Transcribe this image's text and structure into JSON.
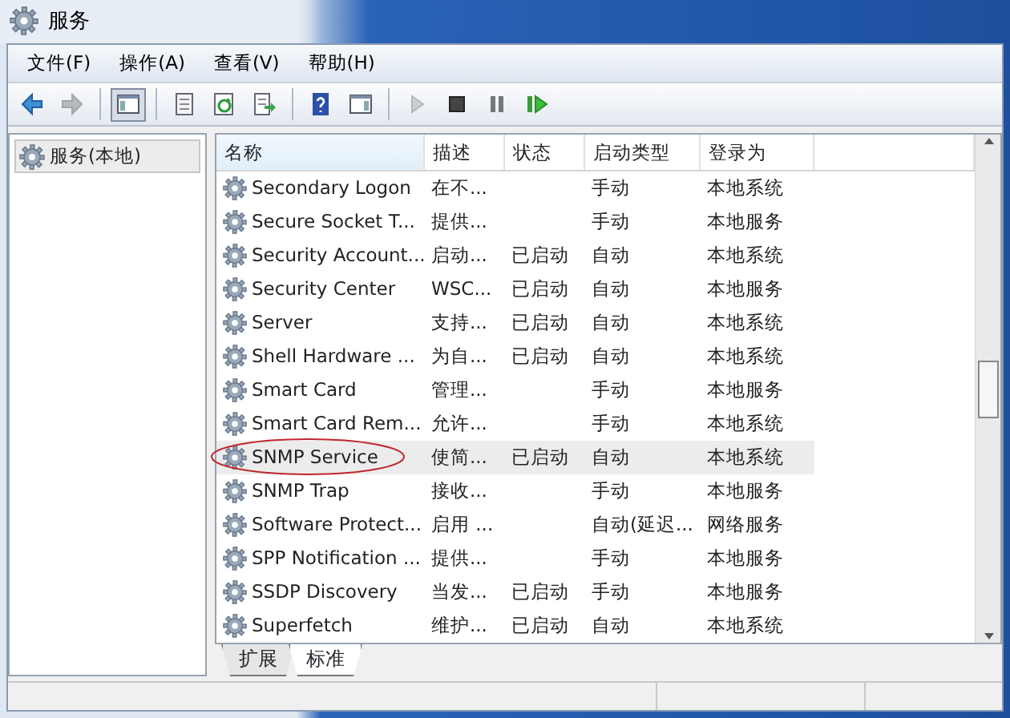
{
  "window": {
    "title": "服务"
  },
  "menu": [
    "文件(F)",
    "操作(A)",
    "查看(V)",
    "帮助(H)"
  ],
  "toolbar": [
    {
      "kind": "back",
      "disabled": false,
      "pressed": false
    },
    {
      "kind": "forward",
      "disabled": true,
      "pressed": false
    },
    {
      "kind": "sep"
    },
    {
      "kind": "tree",
      "disabled": false,
      "pressed": true
    },
    {
      "kind": "sep"
    },
    {
      "kind": "properties",
      "disabled": false,
      "pressed": false
    },
    {
      "kind": "refresh",
      "disabled": false,
      "pressed": false
    },
    {
      "kind": "export",
      "disabled": false,
      "pressed": false
    },
    {
      "kind": "sep"
    },
    {
      "kind": "help",
      "disabled": false,
      "pressed": false
    },
    {
      "kind": "panel",
      "disabled": false,
      "pressed": false
    },
    {
      "kind": "sep"
    },
    {
      "kind": "play",
      "disabled": true,
      "pressed": false
    },
    {
      "kind": "stop",
      "disabled": false,
      "pressed": false
    },
    {
      "kind": "pause",
      "disabled": false,
      "pressed": false
    },
    {
      "kind": "resume",
      "disabled": false,
      "pressed": false
    }
  ],
  "tree": {
    "items": [
      {
        "label": "服务(本地)",
        "selected": true
      }
    ]
  },
  "table": {
    "columns": [
      "名称",
      "描述",
      "状态",
      "启动类型",
      "登录为"
    ],
    "rows": [
      {
        "cells": [
          "Secondary Logon",
          "在不...",
          "",
          "手动",
          "本地系统"
        ],
        "selected": false,
        "circled": false
      },
      {
        "cells": [
          "Secure Socket T...",
          "提供...",
          "",
          "手动",
          "本地服务"
        ],
        "selected": false,
        "circled": false
      },
      {
        "cells": [
          "Security Account...",
          "启动...",
          "已启动",
          "自动",
          "本地系统"
        ],
        "selected": false,
        "circled": false
      },
      {
        "cells": [
          "Security Center",
          "WSC...",
          "已启动",
          "自动",
          "本地服务"
        ],
        "selected": false,
        "circled": false
      },
      {
        "cells": [
          "Server",
          "支持...",
          "已启动",
          "自动",
          "本地系统"
        ],
        "selected": false,
        "circled": false
      },
      {
        "cells": [
          "Shell Hardware ...",
          "为自...",
          "已启动",
          "自动",
          "本地系统"
        ],
        "selected": false,
        "circled": false
      },
      {
        "cells": [
          "Smart Card",
          "管理...",
          "",
          "手动",
          "本地服务"
        ],
        "selected": false,
        "circled": false
      },
      {
        "cells": [
          "Smart Card Rem...",
          "允许...",
          "",
          "手动",
          "本地系统"
        ],
        "selected": false,
        "circled": false
      },
      {
        "cells": [
          "SNMP Service",
          "使简...",
          "已启动",
          "自动",
          "本地系统"
        ],
        "selected": true,
        "circled": true
      },
      {
        "cells": [
          "SNMP Trap",
          "接收...",
          "",
          "手动",
          "本地服务"
        ],
        "selected": false,
        "circled": false
      },
      {
        "cells": [
          "Software Protect...",
          "启用 ...",
          "",
          "自动(延迟...",
          "网络服务"
        ],
        "selected": false,
        "circled": false
      },
      {
        "cells": [
          "SPP Notification ...",
          "提供...",
          "",
          "手动",
          "本地服务"
        ],
        "selected": false,
        "circled": false
      },
      {
        "cells": [
          "SSDP Discovery",
          "当发...",
          "已启动",
          "手动",
          "本地服务"
        ],
        "selected": false,
        "circled": false
      },
      {
        "cells": [
          "Superfetch",
          "维护...",
          "已启动",
          "自动",
          "本地系统"
        ],
        "selected": false,
        "circled": false
      }
    ]
  },
  "view_tabs": [
    {
      "label": "扩展",
      "selected": false
    },
    {
      "label": "标准",
      "selected": true
    }
  ]
}
